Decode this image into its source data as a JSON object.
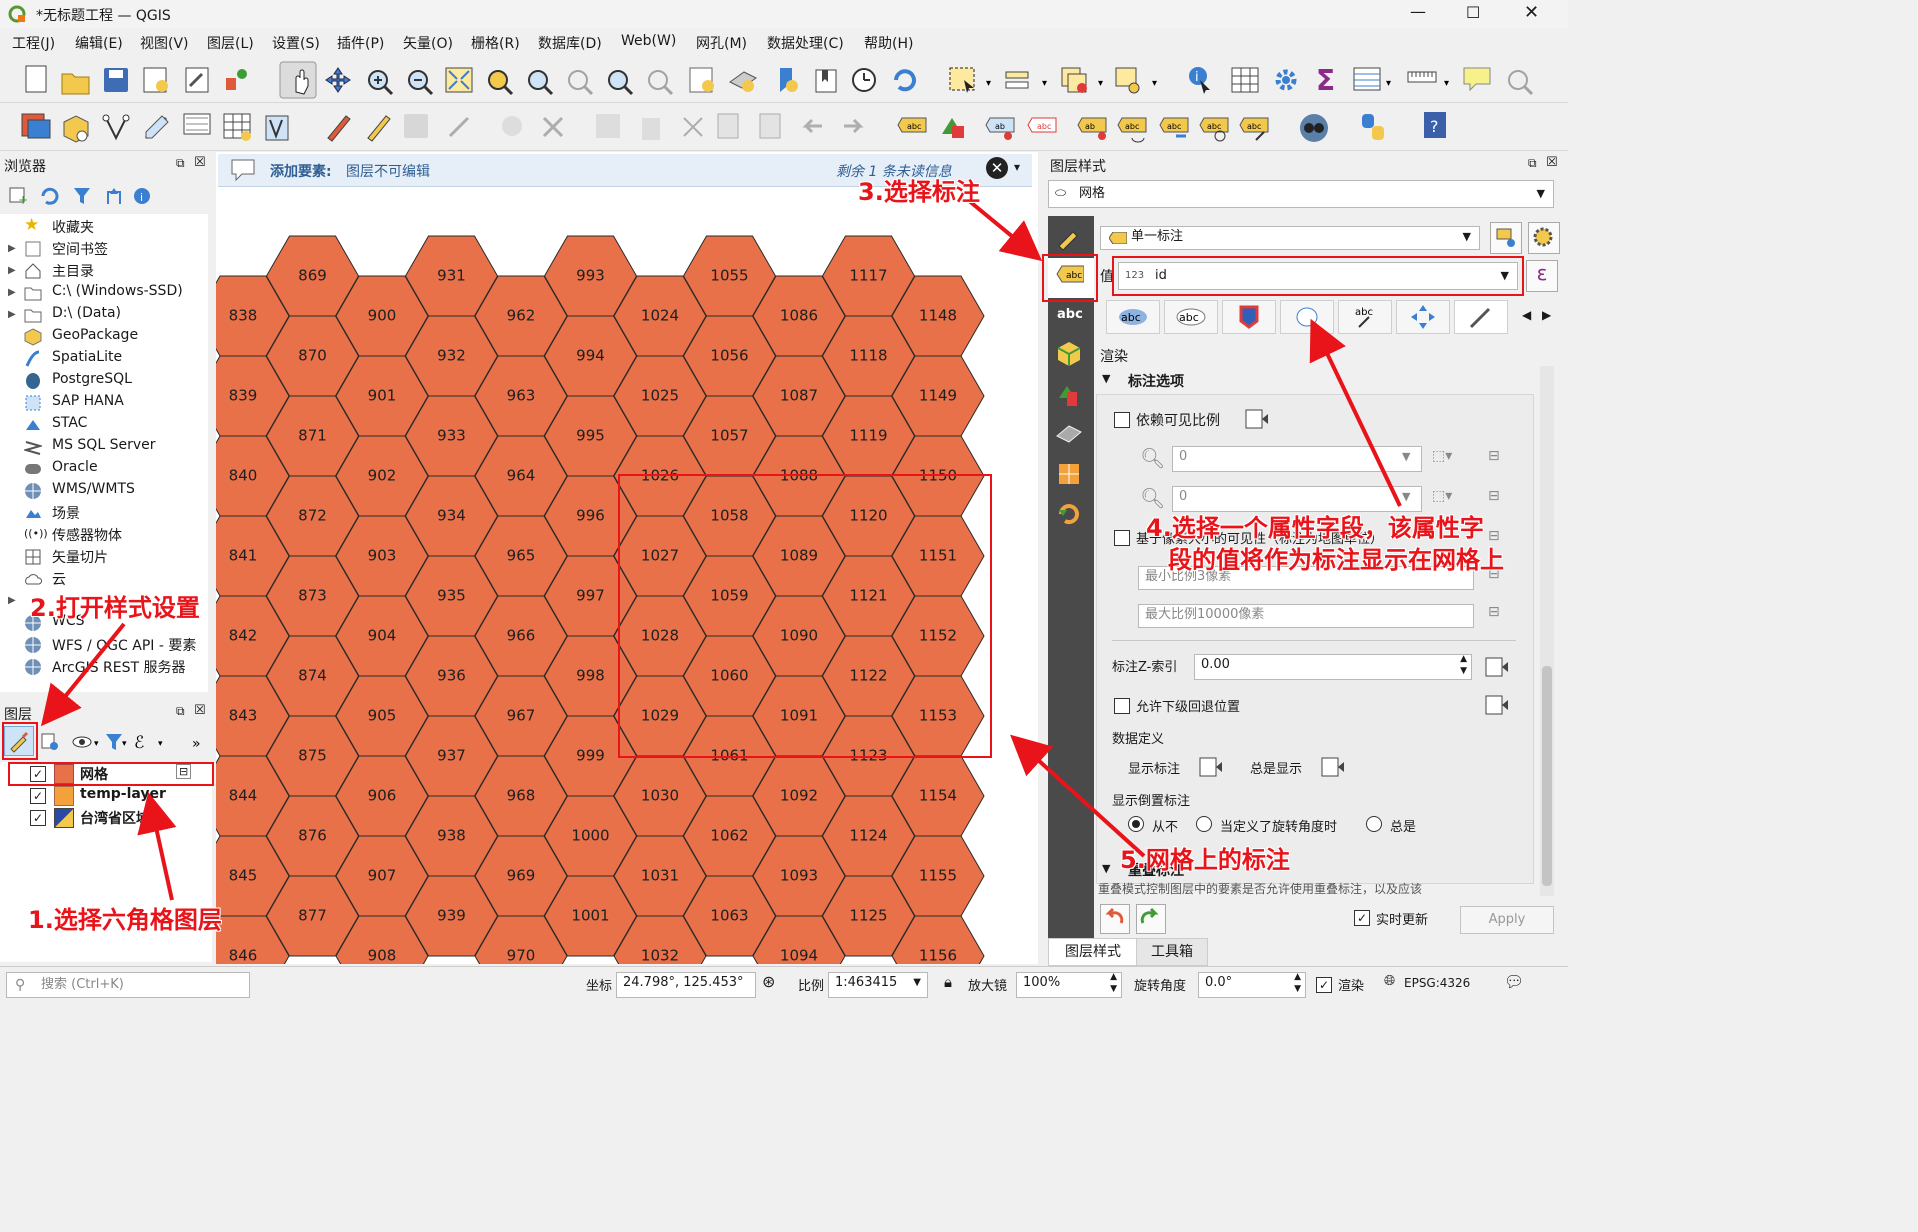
{
  "window": {
    "title": "*无标题工程 — QGIS"
  },
  "menu": [
    "工程(J)",
    "编辑(E)",
    "视图(V)",
    "图层(L)",
    "设置(S)",
    "插件(P)",
    "矢量(O)",
    "栅格(R)",
    "数据库(D)",
    "Web(W)",
    "网孔(M)",
    "数据处理(C)",
    "帮助(H)"
  ],
  "browser": {
    "title": "浏览器",
    "items": [
      "收藏夹",
      "空间书签",
      "主目录",
      "C:\\ (Windows-SSD)",
      "D:\\ (Data)",
      "GeoPackage",
      "SpatiaLite",
      "PostgreSQL",
      "SAP HANA",
      "STAC",
      "MS SQL Server",
      "Oracle",
      "WMS/WMTS",
      "场景",
      "传感器物体",
      "矢量切片",
      "云",
      "WCS",
      "WFS / OGC API - 要素",
      "ArcGIS REST 服务器"
    ]
  },
  "layers": {
    "title": "图层",
    "items": [
      "网格",
      "temp-layer",
      "台湾省区域"
    ]
  },
  "message_bar": {
    "title": "添加要素:",
    "text": "图层不可编辑",
    "remaining": "剩余 1 条未读信息"
  },
  "style_panel": {
    "title": "图层样式",
    "layer": "网格",
    "label_mode": "单一标注",
    "value_label": "值",
    "value_field": "id",
    "value_type": "123",
    "section": "渲染",
    "subsection": "标注选项",
    "scale_dep": "依赖可见比例",
    "scale_min": "0",
    "scale_max": "0",
    "pixel_vis": "基于像素大小的可见性（标注为地图单位）",
    "min_px": "最小比例3像素",
    "max_px": "最大比例10000像素",
    "zindex_label": "标注Z-索引",
    "zindex": "0.00",
    "fallback": "允许下级回退位置",
    "data_defined": "数据定义",
    "show_label": "显示标注",
    "always_show": "总是显示",
    "upside": "显示倒置标注",
    "opt_never": "从不",
    "opt_rot": "当定义了旋转角度时",
    "opt_always": "总是",
    "overlap": "重叠标注",
    "overlap_desc": "重叠模式控制图层中的要素是否允许使用重叠标注，以及应该",
    "live_update": "实时更新",
    "apply": "Apply",
    "tab1": "图层样式",
    "tab2": "工具箱"
  },
  "statusbar": {
    "search": "搜索 (Ctrl+K)",
    "coord_label": "坐标",
    "coord": "24.798°, 125.453°",
    "scale_label": "比例",
    "scale": "1:463415",
    "mag_label": "放大镜",
    "mag": "100%",
    "rot_label": "旋转角度",
    "rot": "0.0°",
    "render": "渲染",
    "crs": "EPSG:4326"
  },
  "annotations": {
    "a1": "1.选择六角格图层",
    "a2": "2.打开样式设置",
    "a3": "3.选择标注",
    "a4a": "4.选择一个属性字段，该属性字",
    "a4b": "段的值将作为标注显示在网格上",
    "a5": "5.网格上的标注"
  },
  "colors": {
    "hex_fill": "#e8714a",
    "annotation": "#e8141a"
  },
  "map": {
    "columns": [
      {
        "start": 838,
        "count": 9
      },
      {
        "start": 869,
        "count": 9
      },
      {
        "start": 900,
        "count": 9
      },
      {
        "start": 931,
        "count": 9
      },
      {
        "start": 962,
        "count": 9
      },
      {
        "start": 993,
        "count": 9
      },
      {
        "start": 1024,
        "count": 9
      },
      {
        "start": 1055,
        "count": 9
      },
      {
        "start": 1086,
        "count": 9
      },
      {
        "start": 1117,
        "count": 9
      },
      {
        "start": 1148,
        "count": 9
      }
    ]
  }
}
